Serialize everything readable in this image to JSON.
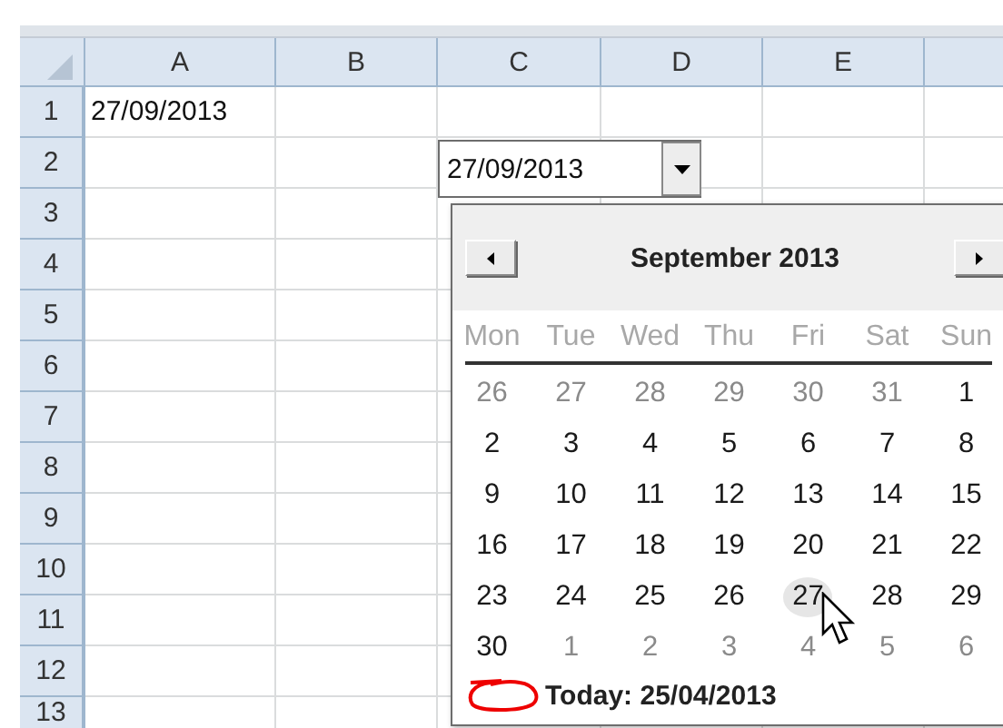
{
  "sheet": {
    "columns": [
      {
        "label": "A"
      },
      {
        "label": "B"
      },
      {
        "label": "C"
      },
      {
        "label": "D"
      },
      {
        "label": "E"
      }
    ],
    "rows": [
      {
        "label": "1",
        "cells": [
          "27/09/2013"
        ]
      },
      {
        "label": "2",
        "cells": []
      },
      {
        "label": "3",
        "cells": []
      },
      {
        "label": "4",
        "cells": []
      },
      {
        "label": "5",
        "cells": []
      },
      {
        "label": "6",
        "cells": []
      },
      {
        "label": "7",
        "cells": []
      },
      {
        "label": "8",
        "cells": []
      },
      {
        "label": "9",
        "cells": []
      },
      {
        "label": "10",
        "cells": []
      },
      {
        "label": "11",
        "cells": []
      },
      {
        "label": "12",
        "cells": []
      },
      {
        "label": "13",
        "cells": []
      }
    ]
  },
  "date_field": {
    "value": "27/09/2013"
  },
  "calendar": {
    "title": "September 2013",
    "day_names": [
      "Mon",
      "Tue",
      "Wed",
      "Thu",
      "Fri",
      "Sat",
      "Sun"
    ],
    "weeks": [
      [
        {
          "day": "26",
          "muted": true,
          "selected": false
        },
        {
          "day": "27",
          "muted": true,
          "selected": false
        },
        {
          "day": "28",
          "muted": true,
          "selected": false
        },
        {
          "day": "29",
          "muted": true,
          "selected": false
        },
        {
          "day": "30",
          "muted": true,
          "selected": false
        },
        {
          "day": "31",
          "muted": true,
          "selected": false
        },
        {
          "day": "1",
          "muted": false,
          "selected": false
        }
      ],
      [
        {
          "day": "2",
          "muted": false,
          "selected": false
        },
        {
          "day": "3",
          "muted": false,
          "selected": false
        },
        {
          "day": "4",
          "muted": false,
          "selected": false
        },
        {
          "day": "5",
          "muted": false,
          "selected": false
        },
        {
          "day": "6",
          "muted": false,
          "selected": false
        },
        {
          "day": "7",
          "muted": false,
          "selected": false
        },
        {
          "day": "8",
          "muted": false,
          "selected": false
        }
      ],
      [
        {
          "day": "9",
          "muted": false,
          "selected": false
        },
        {
          "day": "10",
          "muted": false,
          "selected": false
        },
        {
          "day": "11",
          "muted": false,
          "selected": false
        },
        {
          "day": "12",
          "muted": false,
          "selected": false
        },
        {
          "day": "13",
          "muted": false,
          "selected": false
        },
        {
          "day": "14",
          "muted": false,
          "selected": false
        },
        {
          "day": "15",
          "muted": false,
          "selected": false
        }
      ],
      [
        {
          "day": "16",
          "muted": false,
          "selected": false
        },
        {
          "day": "17",
          "muted": false,
          "selected": false
        },
        {
          "day": "18",
          "muted": false,
          "selected": false
        },
        {
          "day": "19",
          "muted": false,
          "selected": false
        },
        {
          "day": "20",
          "muted": false,
          "selected": false
        },
        {
          "day": "21",
          "muted": false,
          "selected": false
        },
        {
          "day": "22",
          "muted": false,
          "selected": false
        }
      ],
      [
        {
          "day": "23",
          "muted": false,
          "selected": false
        },
        {
          "day": "24",
          "muted": false,
          "selected": false
        },
        {
          "day": "25",
          "muted": false,
          "selected": false
        },
        {
          "day": "26",
          "muted": false,
          "selected": false
        },
        {
          "day": "27",
          "muted": false,
          "selected": true
        },
        {
          "day": "28",
          "muted": false,
          "selected": false
        },
        {
          "day": "29",
          "muted": false,
          "selected": false
        }
      ],
      [
        {
          "day": "30",
          "muted": false,
          "selected": false
        },
        {
          "day": "1",
          "muted": true,
          "selected": false
        },
        {
          "day": "2",
          "muted": true,
          "selected": false
        },
        {
          "day": "3",
          "muted": true,
          "selected": false
        },
        {
          "day": "4",
          "muted": true,
          "selected": false
        },
        {
          "day": "5",
          "muted": true,
          "selected": false
        },
        {
          "day": "6",
          "muted": true,
          "selected": false
        }
      ]
    ],
    "today": "Today: 25/04/2013"
  }
}
